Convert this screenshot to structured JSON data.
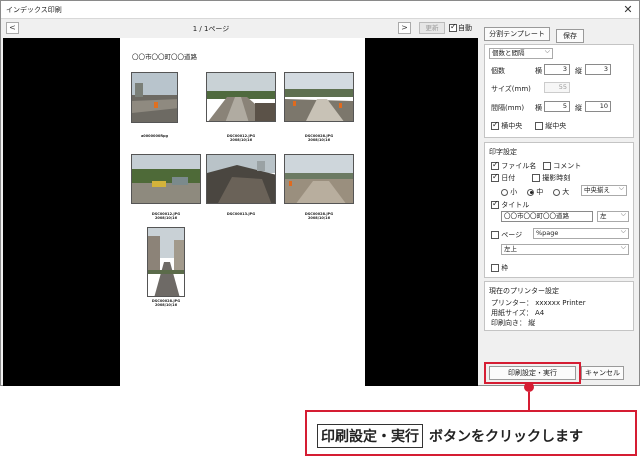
{
  "window": {
    "title": "インデックス印刷",
    "close_glyph": "✕"
  },
  "toolbar": {
    "prev_glyph": "<",
    "next_glyph": ">",
    "page_indicator": "1 / 1ページ",
    "update_label": "更新",
    "auto_label": "自動",
    "auto_checked": true
  },
  "preview": {
    "doc_title": "〇〇市〇〇町〇〇道路",
    "photos": [
      {
        "caption_line1": "a0000000Rpg",
        "caption_line2": ""
      },
      {
        "caption_line1": "DSC00012.JPG",
        "caption_line2": "2008/10/16"
      },
      {
        "caption_line1": "DSC00028.JPG",
        "caption_line2": "2008/10/16"
      },
      {
        "caption_line1": "DSC00012.JPG",
        "caption_line2": "2008/10/16"
      },
      {
        "caption_line1": "DSC00013.JPG",
        "caption_line2": ""
      },
      {
        "caption_line1": "DSC00028.JPG",
        "caption_line2": "2008/10/16"
      },
      {
        "caption_line1": "DSC00028.JPG",
        "caption_line2": "2008/10/16"
      }
    ]
  },
  "panel": {
    "template_button": "分割テンプレート",
    "save_button": "保存",
    "layout_mode": "個数と間隔",
    "count_label": "個数",
    "horizontal_label": "横",
    "vertical_label": "縦",
    "count_h": "3",
    "count_v": "3",
    "size_label": "サイズ(mm)",
    "size_value": "55",
    "spacing_label": "間隔(mm)",
    "spacing_h": "5",
    "spacing_v": "10",
    "center_h_label": "横中央",
    "center_h_checked": true,
    "center_v_label": "縦中央",
    "center_v_checked": false,
    "print_settings_heading": "印字設定",
    "filename_label": "ファイル名",
    "filename_checked": true,
    "comment_label": "コメント",
    "comment_checked": false,
    "date_label": "日付",
    "date_checked": true,
    "shoot_time_label": "撮影時刻",
    "shoot_time_checked": false,
    "size_small": "小",
    "size_medium": "中",
    "size_large": "大",
    "size_selected": "中",
    "align_select": "中央揃え",
    "title_label": "タイトル",
    "title_checked": true,
    "title_value": "〇〇市〇〇町〇〇道路",
    "title_align": "左",
    "page_label": "ページ",
    "page_checked": false,
    "page_format": "%page",
    "page_position": "左上",
    "frame_label": "枠",
    "frame_checked": false,
    "printer_heading": "現在のプリンター設定",
    "printer_line": "プリンター：  xxxxxx Printer",
    "paper_line": "用紙サイズ：  A4",
    "orientation_line": "印刷向き：    縦"
  },
  "buttons": {
    "print_execute": "印刷設定・実行",
    "cancel": "キャンセル"
  },
  "callout": {
    "button_name": "印刷設定・実行",
    "instruction": "ボタンをクリックします"
  },
  "colors": {
    "accent_red": "#d51d33"
  }
}
